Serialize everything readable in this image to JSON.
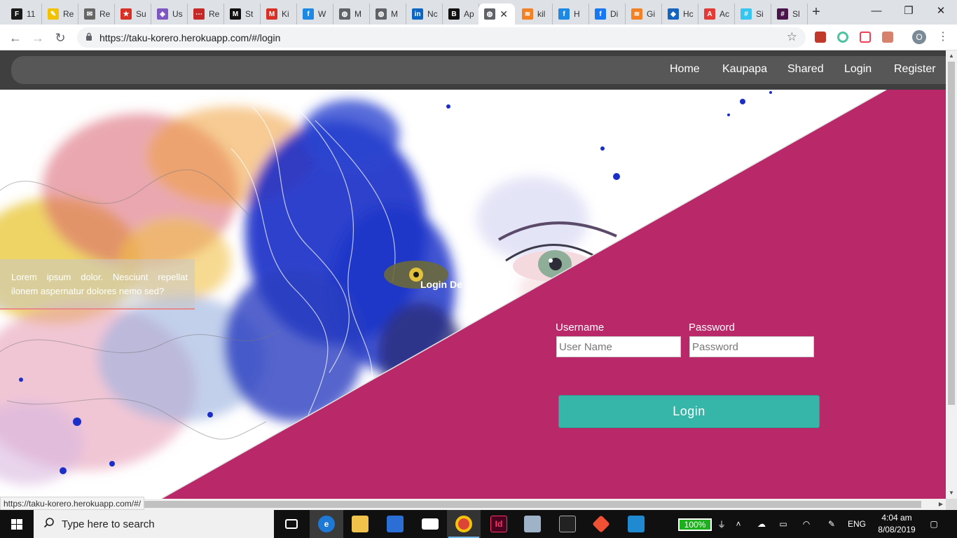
{
  "browser": {
    "tabs": [
      {
        "label": "11",
        "color": "#1a1a1a",
        "glyph": "F"
      },
      {
        "label": "Re",
        "color": "#f2c200",
        "glyph": "✎"
      },
      {
        "label": "Re",
        "color": "#666666",
        "glyph": "✉"
      },
      {
        "label": "Su",
        "color": "#d93025",
        "glyph": "★"
      },
      {
        "label": "Us",
        "color": "#7e57c2",
        "glyph": "◈"
      },
      {
        "label": "Re",
        "color": "#c62828",
        "glyph": "⋯"
      },
      {
        "label": "St",
        "color": "#111111",
        "glyph": "M"
      },
      {
        "label": "Ki",
        "color": "#d93025",
        "glyph": "M"
      },
      {
        "label": "W",
        "color": "#1e88e5",
        "glyph": "f"
      },
      {
        "label": "M",
        "color": "#5f6368",
        "glyph": "◍"
      },
      {
        "label": "M",
        "color": "#5f6368",
        "glyph": "◍"
      },
      {
        "label": "Nc",
        "color": "#0a66c2",
        "glyph": "in"
      },
      {
        "label": "Ap",
        "color": "#111111",
        "glyph": "B"
      }
    ],
    "active_tab": {
      "label": "",
      "close": "✕"
    },
    "tabs_right": [
      {
        "label": "kil",
        "color": "#f48024",
        "glyph": "≋"
      },
      {
        "label": "H",
        "color": "#1e88e5",
        "glyph": "f"
      },
      {
        "label": "Di",
        "color": "#1877f2",
        "glyph": "f"
      },
      {
        "label": "Gi",
        "color": "#f48024",
        "glyph": "≋"
      },
      {
        "label": "Hc",
        "color": "#1565c0",
        "glyph": "◆"
      },
      {
        "label": "Ac",
        "color": "#e53935",
        "glyph": "A"
      },
      {
        "label": "Si",
        "color": "#36c5f0",
        "glyph": "#"
      },
      {
        "label": "Sl",
        "color": "#4a154b",
        "glyph": "#"
      }
    ],
    "new_tab": "+",
    "window_controls": {
      "minimize": "—",
      "restore": "❐",
      "close": "✕"
    },
    "url": "https://taku-korero.herokuapp.com/#/login",
    "profile_initial": "O",
    "status_url": "https://taku-korero.herokuapp.com/#/"
  },
  "site": {
    "nav": [
      "Home",
      "Kaupapa",
      "Shared",
      "Login",
      "Register"
    ],
    "caption": "Lorem ipsum dolor. Nesciunt repellat ilonem aspernatur dolores nemo sed?",
    "login_demo": "Login De",
    "form": {
      "username_label": "Username",
      "username_placeholder": "User Name",
      "password_label": "Password",
      "password_placeholder": "Password",
      "submit": "Login"
    },
    "colors": {
      "magenta": "#b9296a",
      "teal": "#35b6a8",
      "navbar": "#3f3f3f"
    }
  },
  "taskbar": {
    "search_placeholder": "Type here to search",
    "battery": "100%",
    "language": "ENG",
    "time": "4:04 am",
    "date": "8/08/2019"
  }
}
